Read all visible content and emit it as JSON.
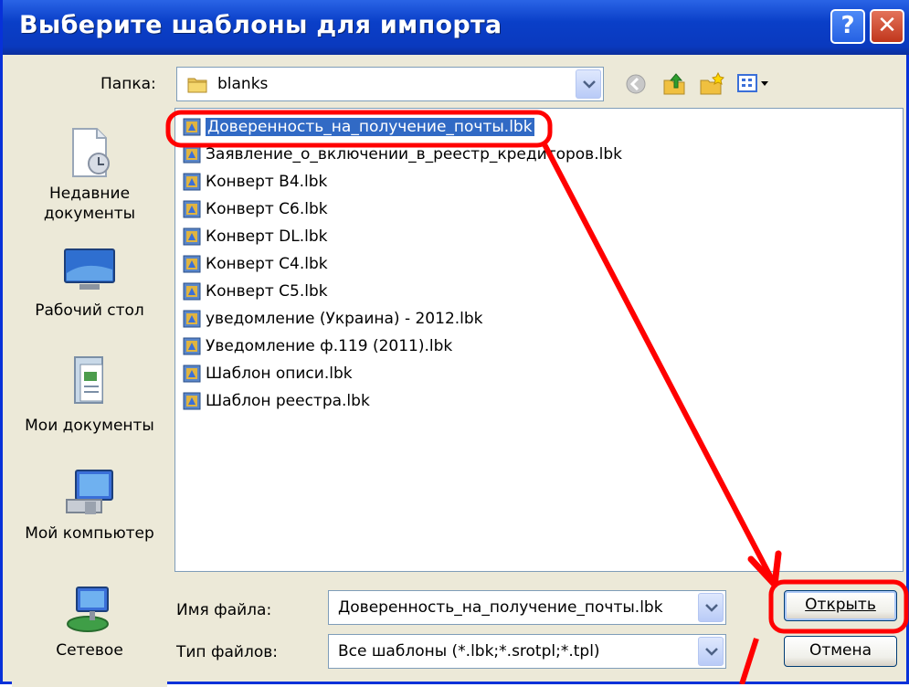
{
  "window": {
    "title": "Выберите шаблоны для импорта",
    "help_glyph": "?",
    "close_glyph": "✕"
  },
  "folder": {
    "label": "Папка:",
    "value": "blanks"
  },
  "places": [
    {
      "label": "Недавние документы",
      "icon": "recent-documents-icon"
    },
    {
      "label": "Рабочий стол",
      "icon": "desktop-icon"
    },
    {
      "label": "Мои документы",
      "icon": "my-documents-icon"
    },
    {
      "label": "Мой компьютер",
      "icon": "my-computer-icon"
    },
    {
      "label": "Сетевое",
      "icon": "network-icon"
    }
  ],
  "files": [
    {
      "name": "Доверенность_на_получение_почты.lbk",
      "selected": true
    },
    {
      "name": "Заявление_о_включении_в_реестр_кредиторов.lbk",
      "selected": false
    },
    {
      "name": "Конверт B4.lbk",
      "selected": false
    },
    {
      "name": "Конверт C6.lbk",
      "selected": false
    },
    {
      "name": "Конверт DL.lbk",
      "selected": false
    },
    {
      "name": "Конверт C4.lbk",
      "selected": false
    },
    {
      "name": "Конверт C5.lbk",
      "selected": false
    },
    {
      "name": "уведомление (Украина) - 2012.lbk",
      "selected": false
    },
    {
      "name": "Уведомление ф.119 (2011).lbk",
      "selected": false
    },
    {
      "name": "Шаблон описи.lbk",
      "selected": false
    },
    {
      "name": "Шаблон реестра.lbk",
      "selected": false
    }
  ],
  "filename": {
    "label": "Имя файла:",
    "value": "Доверенность_на_получение_почты.lbk"
  },
  "filetype": {
    "label": "Тип файлов:",
    "value": "Все шаблоны (*.lbk;*.srotpl;*.tpl)"
  },
  "buttons": {
    "open": "Открыть",
    "cancel": "Отмена"
  },
  "colors": {
    "titlebar": "#0a3fc8",
    "selection": "#316ac5",
    "annotation": "#ff0000"
  }
}
